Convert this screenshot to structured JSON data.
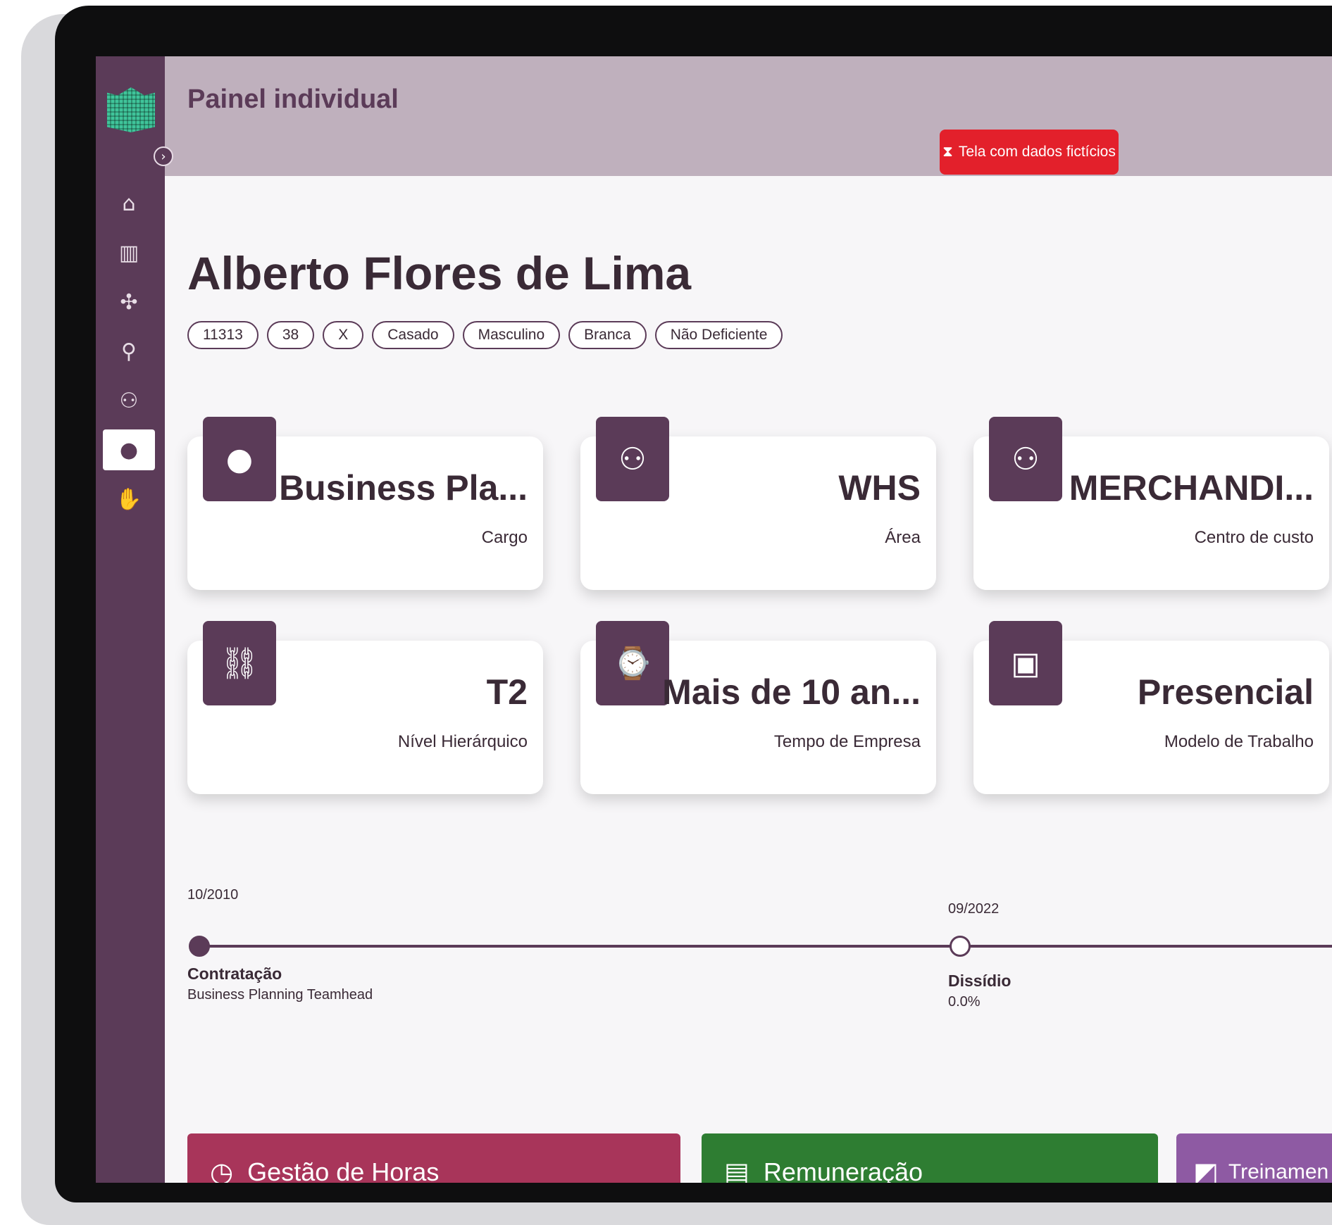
{
  "header": {
    "title": "Painel individual",
    "demo_badge": "Tela com dados fictícios",
    "demo_icon": "hourglass-icon"
  },
  "sidebar": {
    "items": [
      {
        "icon": "home-icon",
        "glyph": "⌂"
      },
      {
        "icon": "chart-icon",
        "glyph": "▥"
      },
      {
        "icon": "network-icon",
        "glyph": "✣"
      },
      {
        "icon": "person-info-icon",
        "glyph": "⚲"
      },
      {
        "icon": "team-icon",
        "glyph": "⚇"
      },
      {
        "icon": "user-icon",
        "glyph": "●",
        "active": true
      },
      {
        "icon": "handshake-icon",
        "glyph": "✋"
      }
    ]
  },
  "employee": {
    "name": "Alberto Flores de Lima",
    "tags": [
      "11313",
      "38",
      "X",
      "Casado",
      "Masculino",
      "Branca",
      "Não Deficiente"
    ]
  },
  "cards": [
    {
      "icon": "user-icon",
      "value": "Business Pla...",
      "label": "Cargo"
    },
    {
      "icon": "group-icon",
      "value": "WHS",
      "label": "Área"
    },
    {
      "icon": "group-icon",
      "value": "MERCHANDI...",
      "label": "Centro de custo"
    },
    {
      "icon": "hierarchy-icon",
      "value": "T2",
      "label": "Nível Hierárquico"
    },
    {
      "icon": "briefcase-clock-icon",
      "value": "Mais de 10 an...",
      "label": "Tempo de Empresa"
    },
    {
      "icon": "briefcase-icon",
      "value": "Presencial",
      "label": "Modelo de Trabalho"
    }
  ],
  "timeline": [
    {
      "date": "10/2010",
      "title": "Contratação",
      "subtitle": "Business Planning Teamhead"
    },
    {
      "date": "09/2022",
      "title": "Dissídio",
      "subtitle": "0.0%"
    }
  ],
  "panels": [
    {
      "icon": "clock-icon",
      "label": "Gestão de Horas",
      "color": "#a8355a"
    },
    {
      "icon": "money-icon",
      "label": "Remuneração",
      "color": "#2e7d32"
    },
    {
      "icon": "training-icon",
      "label": "Treinamen",
      "color": "#8e5aa3"
    }
  ]
}
